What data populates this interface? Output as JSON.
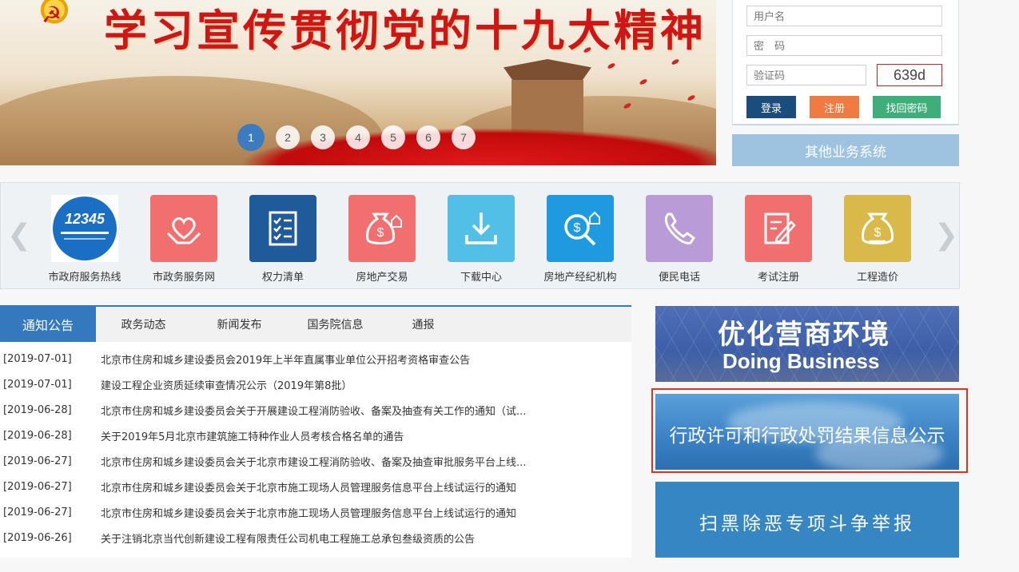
{
  "banner": {
    "title": "学习宣传贯彻党的十九大精神",
    "pages": [
      "1",
      "2",
      "3",
      "4",
      "5",
      "6",
      "7"
    ],
    "active_page": "1"
  },
  "login": {
    "username_placeholder": "用户名",
    "password_placeholder": "密　码",
    "captcha_placeholder": "验证码",
    "captcha_code": "639d",
    "login_label": "登录",
    "register_label": "注册",
    "recover_label": "找回密码",
    "colors": {
      "login": "#1b4d7c",
      "register": "#ef7a42",
      "recover": "#3fae7b"
    }
  },
  "other_systems": "其他业务系统",
  "services": [
    {
      "label": "市政府服务热线",
      "icon": "hotline-12345-icon",
      "color": "#ffffff",
      "logo_text": "12345"
    },
    {
      "label": "市政务服务网",
      "icon": "heart-hands-icon",
      "color": "#f26f6f"
    },
    {
      "label": "权力清单",
      "icon": "checklist-icon",
      "color": "#1f5a9a"
    },
    {
      "label": "房地产交易",
      "icon": "money-bag-house-icon",
      "color": "#f26f6f"
    },
    {
      "label": "下载中心",
      "icon": "download-icon",
      "color": "#52c0e6"
    },
    {
      "label": "房地产经纪机构",
      "icon": "search-money-icon",
      "color": "#1e9be0"
    },
    {
      "label": "便民电话",
      "icon": "phone-icon",
      "color": "#b99bd8"
    },
    {
      "label": "考试注册",
      "icon": "exam-edit-icon",
      "color": "#f26f6f"
    },
    {
      "label": "工程造价",
      "icon": "money-bag-icon",
      "color": "#d9b94a"
    }
  ],
  "tabs": [
    "通知公告",
    "政务动态",
    "新闻发布",
    "国务院信息",
    "通报"
  ],
  "news": [
    {
      "date": "[2019-07-01]",
      "title": "北京市住房和城乡建设委员会2019年上半年直属事业单位公开招考资格审查公告"
    },
    {
      "date": "[2019-07-01]",
      "title": "建设工程企业资质延续审查情况公示（2019年第8批）"
    },
    {
      "date": "[2019-06-28]",
      "title": "北京市住房和城乡建设委员会关于开展建设工程消防验收、备案及抽查有关工作的通知（试..."
    },
    {
      "date": "[2019-06-28]",
      "title": "关于2019年5月北京市建筑施工特种作业人员考核合格名单的通告"
    },
    {
      "date": "[2019-06-27]",
      "title": "北京市住房和城乡建设委员会关于北京市建设工程消防验收、备案及抽查审批服务平台上线..."
    },
    {
      "date": "[2019-06-27]",
      "title": "北京市住房和城乡建设委员会关于北京市施工现场人员管理服务信息平台上线试运行的通知"
    },
    {
      "date": "[2019-06-27]",
      "title": "北京市住房和城乡建设委员会关于北京市施工现场人员管理服务信息平台上线试运行的通知"
    },
    {
      "date": "[2019-06-26]",
      "title": "关于注销北京当代创新建设工程有限责任公司机电工程施工总承包叁级资质的公告"
    }
  ],
  "ads": {
    "business_cn": "优化营商环境",
    "business_en": "Doing Business",
    "permits": "行政许可和行政处罚结果信息公示",
    "report": "扫黑除恶专项斗争举报"
  }
}
